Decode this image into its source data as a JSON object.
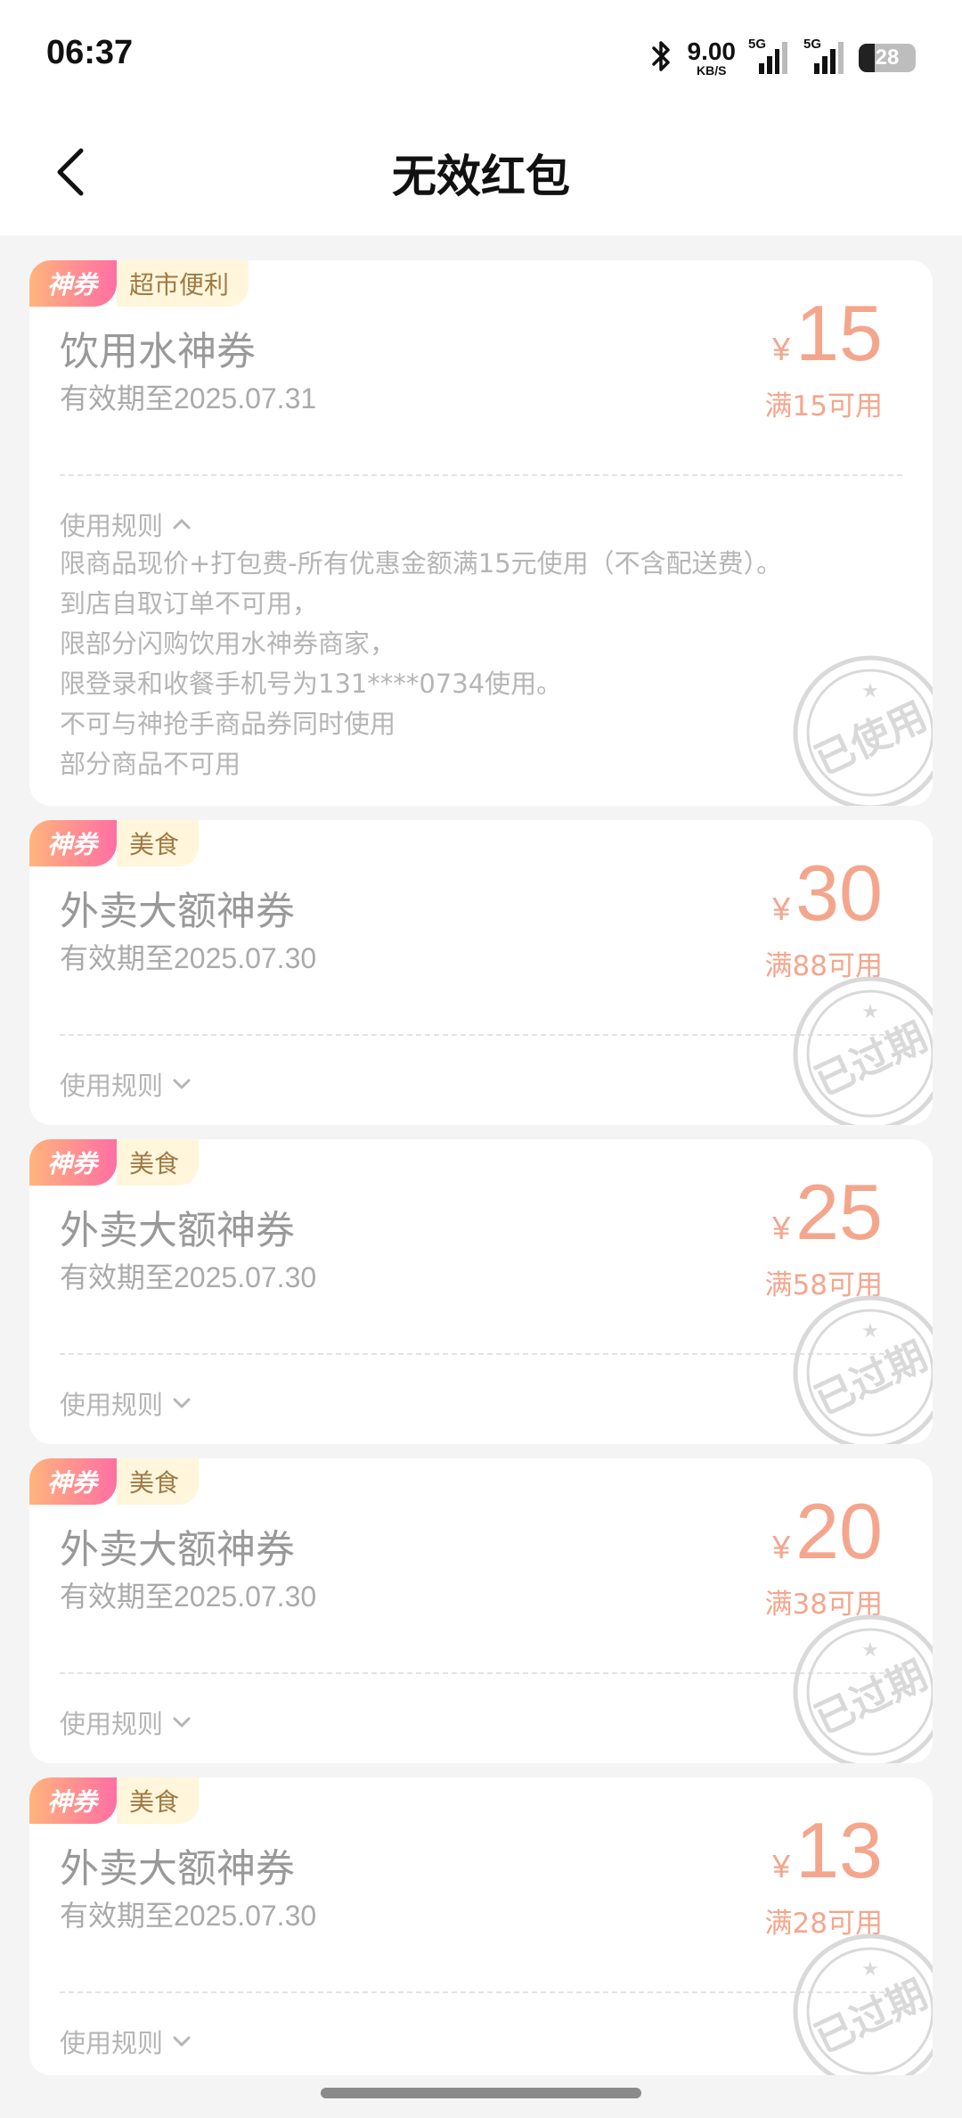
{
  "status_bar": {
    "time": "06:37",
    "net_speed_value": "9.00",
    "net_speed_unit": "KB/S",
    "sim1_label": "5G",
    "sim2_label": "5G",
    "battery_level": "28",
    "icons": [
      "bluetooth-icon",
      "signal-icon",
      "battery-icon"
    ]
  },
  "header": {
    "title": "无效红包",
    "back_icon": "chevron-left-icon"
  },
  "colors": {
    "price": "#f4a68d",
    "tag_gradient_start": "#ffb47c",
    "tag_gradient_end": "#ff6fa3",
    "category_bg": "#fff6dc",
    "page_bg": "#f4f4f4"
  },
  "coupons": [
    {
      "tag": "神券",
      "category": "超市便利",
      "title": "饮用水神券",
      "expiry": "有效期至2025.07.31",
      "currency": "¥",
      "amount": "15",
      "condition": "满15可用",
      "rules_label": "使用规则",
      "rules_expanded": true,
      "rules": [
        "限商品现价+打包费-所有优惠金额满15元使用（不含配送费）。",
        "到店自取订单不可用，",
        "限部分闪购饮用水神券商家，",
        "限登录和收餐手机号为131****0734使用。",
        "不可与神抢手商品券同时使用",
        "部分商品不可用"
      ],
      "stamp": "已使用"
    },
    {
      "tag": "神券",
      "category": "美食",
      "title": "外卖大额神券",
      "expiry": "有效期至2025.07.30",
      "currency": "¥",
      "amount": "30",
      "condition": "满88可用",
      "rules_label": "使用规则",
      "rules_expanded": false,
      "stamp": "已过期"
    },
    {
      "tag": "神券",
      "category": "美食",
      "title": "外卖大额神券",
      "expiry": "有效期至2025.07.30",
      "currency": "¥",
      "amount": "25",
      "condition": "满58可用",
      "rules_label": "使用规则",
      "rules_expanded": false,
      "stamp": "已过期"
    },
    {
      "tag": "神券",
      "category": "美食",
      "title": "外卖大额神券",
      "expiry": "有效期至2025.07.30",
      "currency": "¥",
      "amount": "20",
      "condition": "满38可用",
      "rules_label": "使用规则",
      "rules_expanded": false,
      "stamp": "已过期"
    },
    {
      "tag": "神券",
      "category": "美食",
      "title": "外卖大额神券",
      "expiry": "有效期至2025.07.30",
      "currency": "¥",
      "amount": "13",
      "condition": "满28可用",
      "rules_label": "使用规则",
      "rules_expanded": false,
      "stamp": "已过期"
    }
  ]
}
